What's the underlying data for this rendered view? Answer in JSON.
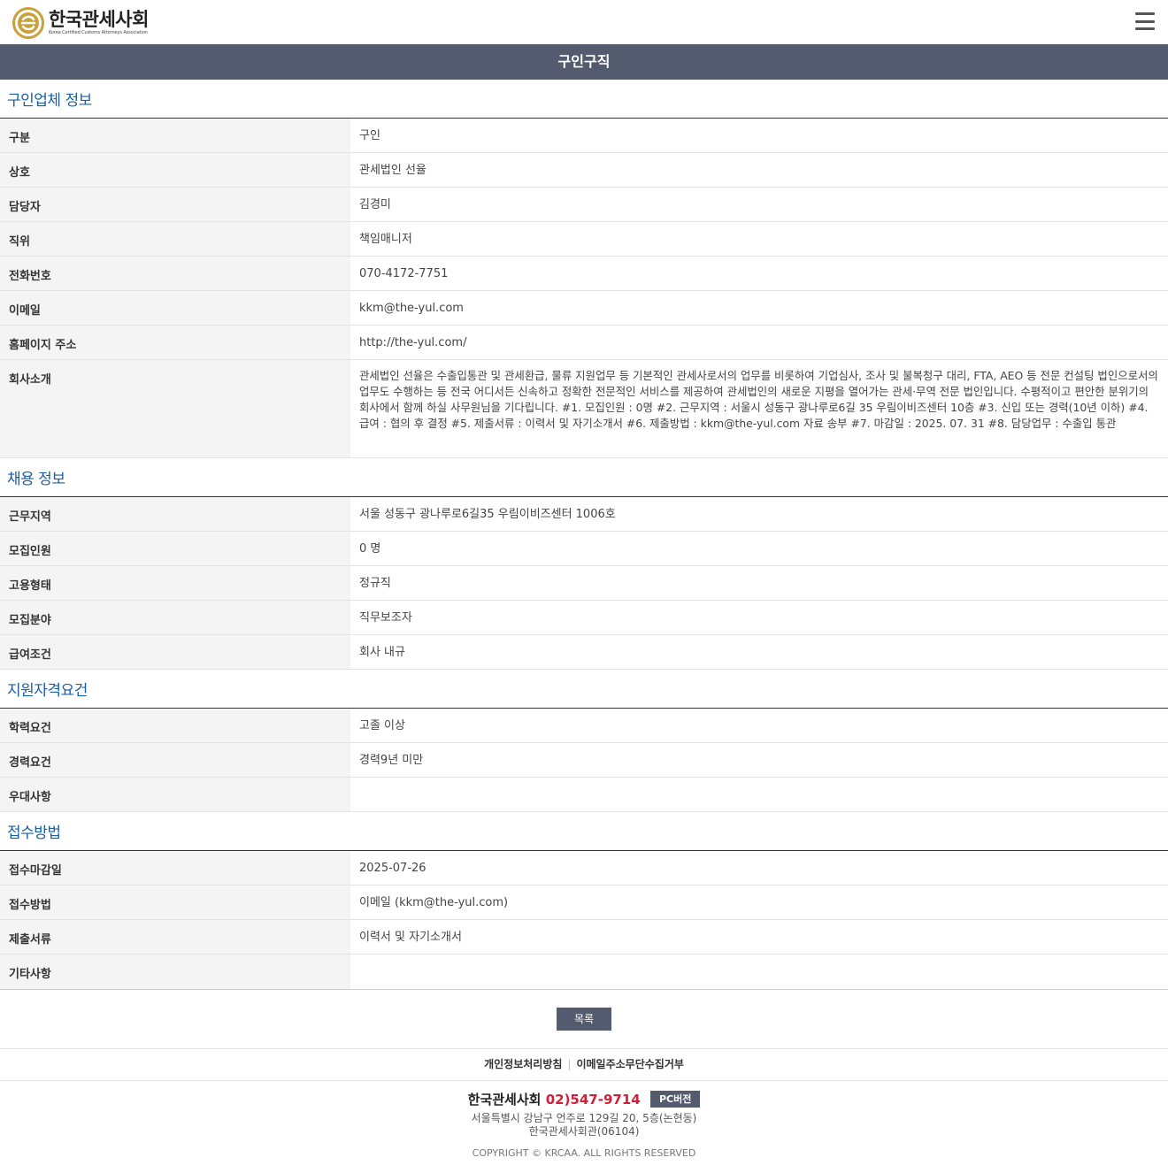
{
  "header": {
    "logo_title": "한국관세사회",
    "logo_sub": "Korea Certified Customs Attorneys Association",
    "menu_icon": "hamburger-menu-icon"
  },
  "page_title": "구인구직",
  "company_section": {
    "title": "구인업체 정보",
    "rows": [
      {
        "label": "구분",
        "value": "구인"
      },
      {
        "label": "상호",
        "value": "관세법인 선율"
      },
      {
        "label": "담당자",
        "value": "김경미"
      },
      {
        "label": "직위",
        "value": "책임매니저"
      },
      {
        "label": "전화번호",
        "value": "070-4172-7751"
      },
      {
        "label": "이메일",
        "value": "kkm@the-yul.com"
      },
      {
        "label": "홈페이지 주소",
        "value": "http://the-yul.com/"
      },
      {
        "label": "회사소개",
        "value": "관세법인 선율은 수출입통관 및 관세환급, 물류 지원업무 등 기본적인 관세사로서의 업무를 비롯하여 기업심사, 조사 및 불복청구 대리, FTA, AEO 등 전문 컨설팅 법인으로서의 업무도 수행하는 등 전국 어디서든 신속하고 정확한 전문적인 서비스를 제공하여 관세법인의 새로운 지평을 열어가는 관세·무역 전문 법인입니다. 수평적이고 편안한 분위기의 회사에서 함께 하실 사무원님을 기다립니다. #1. 모집인원 : 0명 #2. 근무지역 : 서울시 성동구 광나루로6길 35 우림이비즈센터 10층 #3. 신입 또는 경력(10년 이하) #4. 급여 : 협의 후 결정 #5. 제출서류 : 이력서 및 자기소개서 #6. 제출방법 : kkm@the-yul.com 자료 송부 #7. 마감일 : 2025. 07. 31 #8. 담당업무 : 수출입 통관"
      }
    ]
  },
  "job_section": {
    "title": "채용 정보",
    "rows": [
      {
        "label": "근무지역",
        "value": "서울 성동구 광나루로6길35 우림이비즈센터 1006호"
      },
      {
        "label": "모집인원",
        "value": "0 명"
      },
      {
        "label": "고용형태",
        "value": "정규직"
      },
      {
        "label": "모집분야",
        "value": "직무보조자"
      },
      {
        "label": "급여조건",
        "value": "회사 내규"
      }
    ]
  },
  "qual_section": {
    "title": "지원자격요건",
    "rows": [
      {
        "label": "학력요건",
        "value": "고졸 이상"
      },
      {
        "label": "경력요건",
        "value": "경력9년 미만"
      },
      {
        "label": "우대사항",
        "value": ""
      }
    ]
  },
  "apply_section": {
    "title": "접수방법",
    "rows": [
      {
        "label": "접수마감일",
        "value": "2025-07-26"
      },
      {
        "label": "접수방법",
        "value": "이메일 (kkm@the-yul.com)"
      },
      {
        "label": "제출서류",
        "value": "이력서 및 자기소개서"
      },
      {
        "label": "기타사항",
        "value": ""
      }
    ]
  },
  "list_button": "목록",
  "footer": {
    "privacy_link": "개인정보처리방침",
    "email_link": "이메일주소무단수집거부",
    "org_name": "한국관세사회",
    "phone": "02)547-9714",
    "pc_button": "PC버전",
    "address_line1": "서울특별시 강남구 언주로 129길 20, 5층(논현동)",
    "address_line2": "한국관세사회관(06104)",
    "copyright": "COPYRIGHT © KRCAA. ALL RIGHTS RESERVED"
  }
}
